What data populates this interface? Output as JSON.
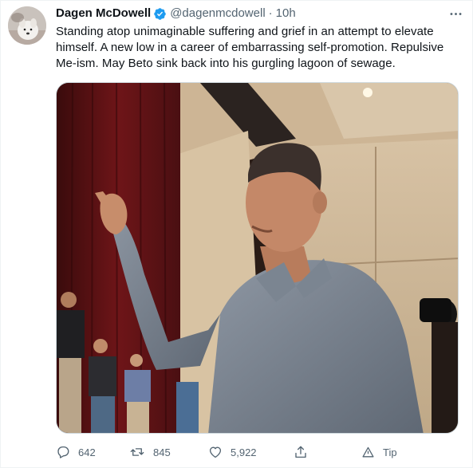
{
  "tweet": {
    "author": {
      "display_name": "Dagen McDowell",
      "handle": "@dagenmcdowell",
      "verified": true
    },
    "separator": "·",
    "time": "10h",
    "text": "Standing atop unimaginable suffering and grief in an attempt to elevate himself. A new low in a career of embarrassing self-promotion. Repulsive Me-ism. May Beto sink back into his gurgling lagoon of sewage.",
    "more_icon": "more-horizontal-icon"
  },
  "actions": {
    "reply": {
      "icon": "reply-icon",
      "count": "642"
    },
    "retweet": {
      "icon": "retweet-icon",
      "count": "845"
    },
    "like": {
      "icon": "heart-icon",
      "count": "5,922"
    },
    "share": {
      "icon": "share-icon"
    },
    "tip": {
      "icon": "tip-icon",
      "label": "Tip"
    }
  },
  "colors": {
    "text_primary": "#0f1419",
    "text_secondary": "#536471",
    "verified_blue": "#1d9bf0",
    "border": "#cfd9de"
  }
}
